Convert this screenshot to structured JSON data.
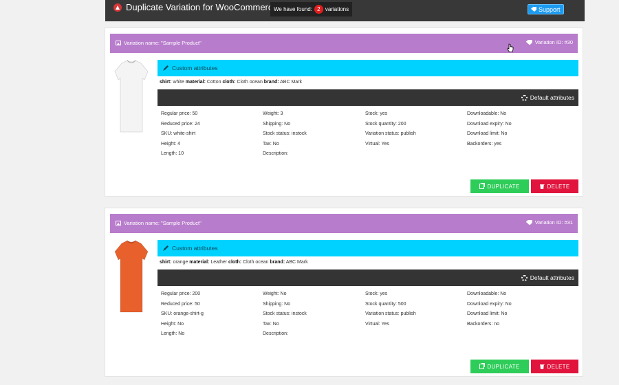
{
  "header": {
    "title": "Duplicate Variation for WooCommerce",
    "found_prefix": "We have found:",
    "found_count": "2",
    "found_suffix": "variations",
    "support_label": "Support"
  },
  "colors": {
    "header_bg": "#383838",
    "variation_bar": "#b87ccc",
    "custom_attr_bar": "#00d2ff",
    "default_attr_bar": "#343434",
    "duplicate": "#2ecc59",
    "delete": "#e0143c"
  },
  "labels": {
    "custom_attributes": "Custom attributes",
    "default_attributes": "Default attributes",
    "duplicate": "DUPLICATE",
    "delete": "DELETE"
  },
  "variations": [
    {
      "name": "Variation name: \"Sample Product\"",
      "variation_id": "Variation ID: #30",
      "shirt_color": "#f4f4f4",
      "attrs": [
        {
          "k": "shirt:",
          "v": "white"
        },
        {
          "k": "material:",
          "v": "Cotton"
        },
        {
          "k": "cloth:",
          "v": "Cloth ocean"
        },
        {
          "k": "brand:",
          "v": "ABC Mark"
        }
      ],
      "details": [
        [
          "Regular price: 50",
          "Reduced price: 24",
          "SKU: white-shirt",
          "Height: 4",
          "Length: 10"
        ],
        [
          "Weight: 3",
          "Shipping: No",
          "Stock status: instock",
          "Tax: No",
          "Description:"
        ],
        [
          "Stock: yes",
          "Stock quantity: 200",
          "Variation status: publish",
          "Virtual: Yes"
        ],
        [
          "Downloadable: No",
          "Download expiry: No",
          "Download limit: No",
          "Backorders: yes"
        ]
      ]
    },
    {
      "name": "Variation name: \"Sample Product\"",
      "variation_id": "Variation ID: #31",
      "shirt_color": "#e8602c",
      "attrs": [
        {
          "k": "shirt:",
          "v": "orange"
        },
        {
          "k": "material:",
          "v": "Leather"
        },
        {
          "k": "cloth:",
          "v": "Cloth ocean"
        },
        {
          "k": "brand:",
          "v": "ABC Mark"
        }
      ],
      "details": [
        [
          "Regular price: 200",
          "Reduced price: 50",
          "SKU: orange-shirt-g",
          "Height: No",
          "Length: No"
        ],
        [
          "Weight: No",
          "Shipping: No",
          "Stock status: instock",
          "Tax: No",
          "Description:"
        ],
        [
          "Stock: yes",
          "Stock quantity: 500",
          "Variation status: publish",
          "Virtual: Yes"
        ],
        [
          "Downloadable: No",
          "Download expiry: No",
          "Download limit: No",
          "Backorders: no"
        ]
      ]
    }
  ]
}
